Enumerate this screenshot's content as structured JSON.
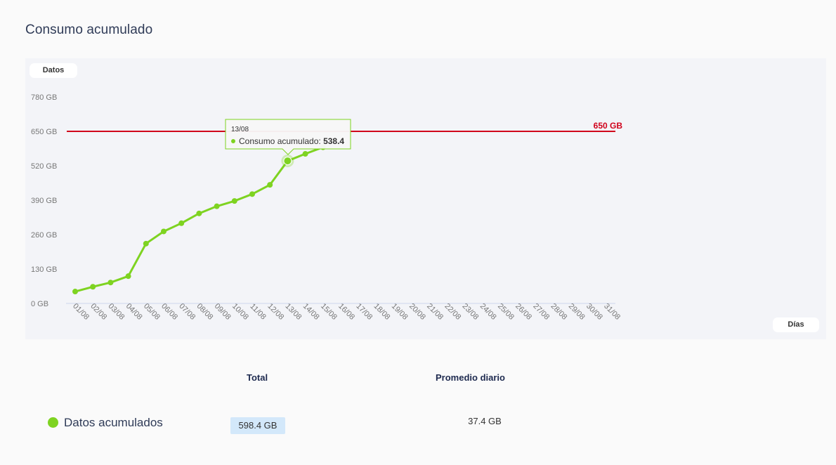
{
  "title": "Consumo acumulado",
  "colors": {
    "series": "#7ed321",
    "threshold": "#d0021b",
    "badge_bg": "#d3e8fa"
  },
  "chart_data": {
    "type": "line",
    "y_axis_label": "Datos",
    "x_axis_label": "Días",
    "y_ticks": [
      "0 GB",
      "130 GB",
      "260 GB",
      "390 GB",
      "520 GB",
      "650 GB",
      "780 GB"
    ],
    "ylim": [
      0,
      780
    ],
    "y_unit": "GB",
    "grid": false,
    "categories": [
      "01/08",
      "02/08",
      "03/08",
      "04/08",
      "05/08",
      "06/08",
      "07/08",
      "08/08",
      "09/08",
      "10/08",
      "11/08",
      "12/08",
      "13/08",
      "14/08",
      "15/08",
      "16/08",
      "17/08",
      "18/08",
      "19/08",
      "20/08",
      "21/08",
      "22/08",
      "23/08",
      "24/08",
      "25/08",
      "26/08",
      "27/08",
      "28/08",
      "29/08",
      "30/08",
      "31/08"
    ],
    "series": [
      {
        "values": [
          45,
          63,
          79,
          103,
          226,
          272,
          303,
          340,
          367,
          387,
          413,
          448,
          538.4,
          565,
          590
        ]
      }
    ],
    "threshold": {
      "value": 650,
      "label": "650 GB"
    },
    "tooltip": {
      "date": "13/08",
      "series_label": "Consumo acumulado: ",
      "value": "538.4",
      "index": 12
    }
  },
  "summary": {
    "total_header": "Total",
    "avg_header": "Promedio diario",
    "series_label": "Datos acumulados",
    "total_value": "598.4 GB",
    "avg_value": "37.4 GB"
  }
}
